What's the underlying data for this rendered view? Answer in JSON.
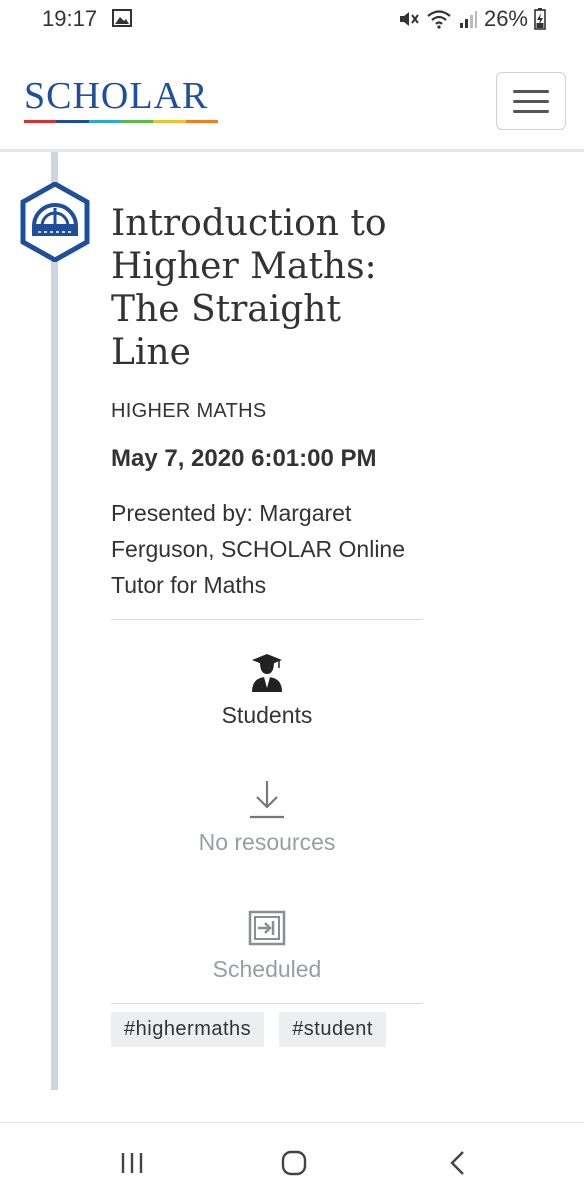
{
  "status_bar": {
    "time": "19:17",
    "battery": "26%",
    "icons": [
      "image-icon",
      "mute-icon",
      "wifi-icon",
      "signal-icon",
      "battery-icon"
    ]
  },
  "header": {
    "logo_text": "SCHOLAR",
    "logo_colors": [
      "#d9322e",
      "#1f4f9a",
      "#2aa8d8",
      "#5aba47",
      "#f2c12e",
      "#ef7d22"
    ],
    "menu_icon": "hamburger-icon"
  },
  "event": {
    "icon": "protractor-icon",
    "title": "Introduction to Higher Maths: The Straight Line",
    "subject": "HIGHER MATHS",
    "date": "May 7, 2020 6:01:00 PM",
    "presenter": "Presented by: Margaret Ferguson, SCHOLAR Online Tutor for Maths",
    "audience": {
      "icon": "graduate-icon",
      "label": "Students"
    },
    "resources": {
      "icon": "download-icon",
      "label": "No resources"
    },
    "status": {
      "icon": "scheduled-icon",
      "label": "Scheduled"
    },
    "tags": [
      "#highermaths",
      "#student"
    ]
  },
  "colors": {
    "brand_blue": "#1f4f9a",
    "timeline": "#cdd6dc",
    "muted_text": "#9a9ea2"
  },
  "nav_bar": {
    "icons": [
      "recent-apps-icon",
      "home-icon",
      "back-icon"
    ]
  }
}
